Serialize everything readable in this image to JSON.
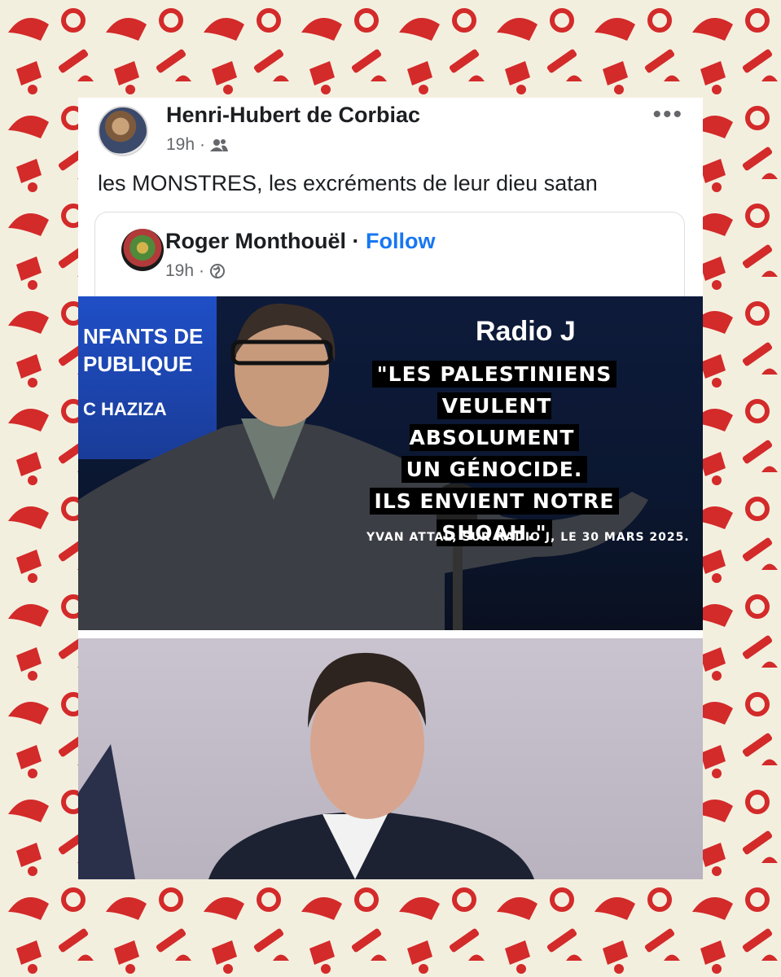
{
  "post": {
    "author": "Henri-Hubert de Corbiac",
    "time": "19h",
    "audience_icon": "friends-icon",
    "more_icon": "more-icon",
    "more_label": "•••",
    "text": "les MONSTRES, les excréments de leur dieu satan"
  },
  "shared": {
    "author": "Roger Monthouël",
    "separator": "·",
    "follow": "Follow",
    "time": "19h",
    "audience_icon": "globe-icon"
  },
  "image1": {
    "studio_lines": [
      "NFANTS DE",
      "PUBLIQUE",
      "C HAZIZA"
    ],
    "radio_logo": "Radio J",
    "quote_lines": [
      "\"LES PALESTINIENS",
      "VEULENT ABSOLUMENT",
      "UN GÉNOCIDE.",
      "ILS ENVIENT NOTRE",
      "SHOAH.\""
    ],
    "caption": "YVAN ATTAL, SUR RADIO J, LE 30 MARS 2025."
  },
  "colors": {
    "background": "#f3efdf",
    "pattern": "#d32a2a",
    "link": "#1877f2"
  }
}
